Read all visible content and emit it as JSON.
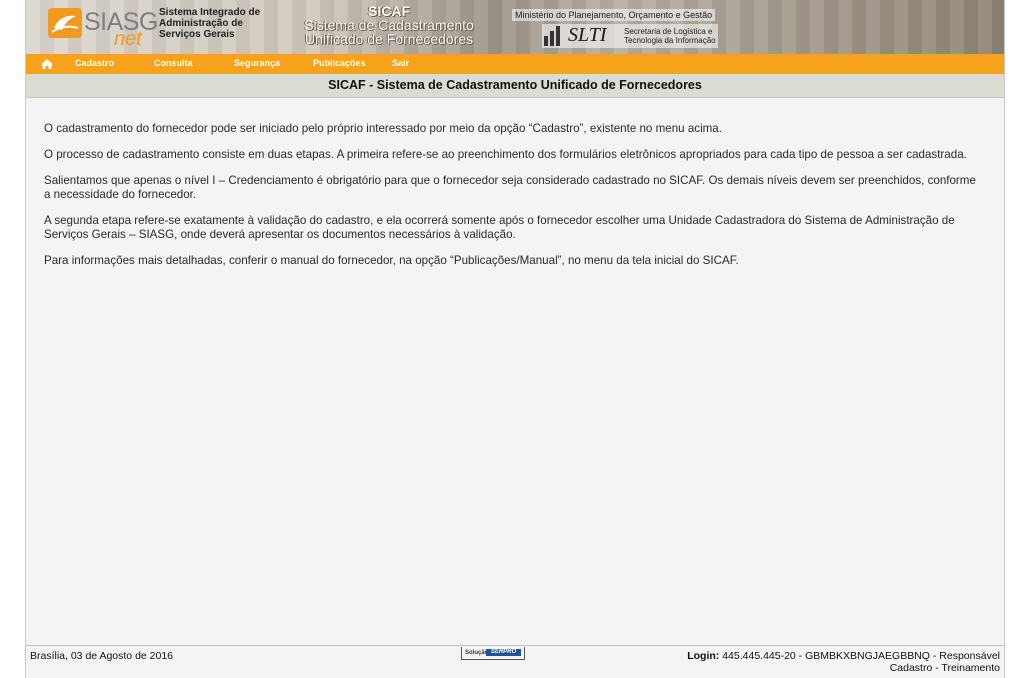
{
  "banner": {
    "logo_text": "SIASG",
    "logo_net": "net",
    "logo_subtitle": [
      "Sistema Integrado de",
      "Administração de",
      "Serviços Gerais"
    ],
    "sicaf_title": "SICAF",
    "sicaf_subtitle_1": "Sistema de Cadastramento",
    "sicaf_subtitle_2": "Unificado de Fornecedores",
    "ministerio": "Ministério do Planejamento, Orçamento e Gestão",
    "slti_text": "SLTI",
    "slti_subtitle": [
      "Secretaria de Logística e",
      "Tecnologia da Informação"
    ]
  },
  "menu": {
    "home_icon": "home-icon",
    "items": [
      "Cadastro",
      "Consulta",
      "Segurança",
      "Publicações",
      "Sair"
    ]
  },
  "page_title": "SICAF - Sistema de Cadastramento Unificado de Fornecedores",
  "content": {
    "paragraphs": [
      "O cadastramento do fornecedor pode ser iniciado pelo próprio interessado por meio da opção “Cadastro”, existente no menu acima.",
      "O processo de cadastramento consiste em duas etapas. A primeira refere-se ao preenchimento dos formulários eletrônicos apropriados para cada tipo de pessoa a ser cadastrada.",
      "Salientamos que apenas o nível I – Credenciamento é obrigatório para que o fornecedor seja considerado cadastrado no SICAF. Os demais níveis devem ser preenchidos, conforme a necessidade do fornecedor.",
      "A segunda etapa refere-se exatamente à validação do cadastro, e ela ocorrerá somente após o fornecedor escolher uma Unidade Cadastradora do Sistema de Administração de Serviços Gerais – SIASG, onde deverá apresentar os documentos necessários à validação.",
      "Para informações mais detalhadas, conferir o manual do fornecedor, na opção “Publicações/Manual”, no menu da tela inicial do SICAF."
    ]
  },
  "footer": {
    "date": "Brasília, 03 de Agosto de 2016",
    "serpro_label": "Solução",
    "serpro_brand": "SERPRO",
    "login_label": "Login:",
    "login_value": "445.445.445-20 - GBMBKXBNGJAEGBBNQ - Responsável",
    "login_line2": "Cadastro - Treinamento"
  },
  "colors": {
    "menu_orange": "#f7a21d",
    "title_bar": "#dcdcd2",
    "background": "#f4f4f4"
  }
}
